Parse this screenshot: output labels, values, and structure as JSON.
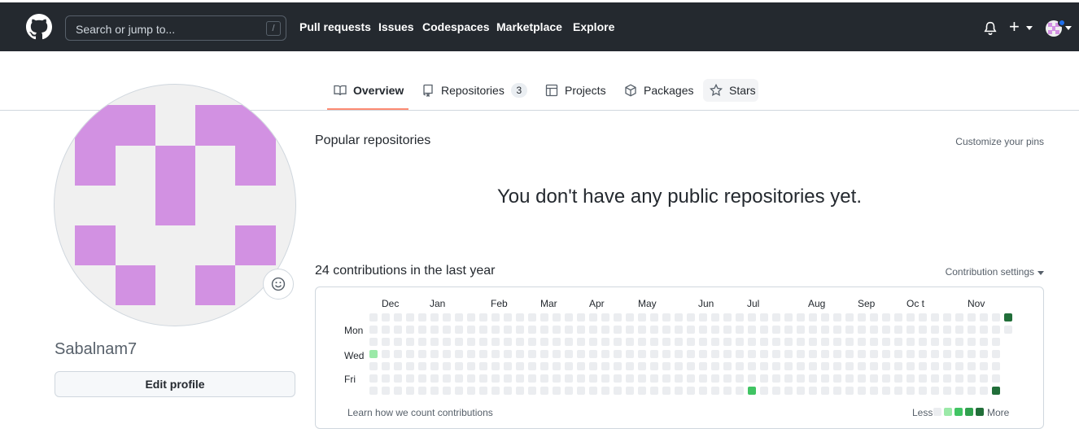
{
  "header": {
    "search_placeholder": "Search or jump to...",
    "search_shortcut": "/",
    "nav": [
      "Pull requests",
      "Issues",
      "Codespaces",
      "Marketplace",
      "Explore"
    ],
    "plus_label": "+"
  },
  "tabs": [
    {
      "label": "Overview",
      "icon": "book-icon",
      "selected": true
    },
    {
      "label": "Repositories",
      "icon": "repo-icon",
      "count": "3"
    },
    {
      "label": "Projects",
      "icon": "project-table-icon"
    },
    {
      "label": "Packages",
      "icon": "package-icon"
    },
    {
      "label": "Stars",
      "icon": "star-icon"
    }
  ],
  "profile": {
    "username": "Sabalnam7",
    "edit_button": "Edit profile",
    "identicon_color": "#d291e2"
  },
  "popular": {
    "title": "Popular repositories",
    "customize_link": "Customize your pins",
    "empty_message": "You don't have any public repositories yet."
  },
  "contributions": {
    "title": "24 contributions in the last year",
    "settings_link": "Contribution settings",
    "months": [
      "Dec",
      "Jan",
      "Feb",
      "Mar",
      "Apr",
      "May",
      "Jun",
      "Jul",
      "Aug",
      "Sep",
      "Oc t",
      "Nov"
    ],
    "day_labels": [
      "Mon",
      "Wed",
      "Fri"
    ],
    "learn_link": "Learn how we count contributions",
    "legend_less": "Less",
    "legend_more": "More",
    "legend_colors": [
      "#ebedf0",
      "#9be9a8",
      "#40c463",
      "#30a14e",
      "#216e39"
    ],
    "weeks": 53,
    "last_week_days": 2,
    "active_cells": [
      {
        "week": 0,
        "day": 3,
        "level": 1
      },
      {
        "week": 31,
        "day": 6,
        "level": 2
      },
      {
        "week": 51,
        "day": 6,
        "level": 4
      },
      {
        "week": 52,
        "day": 0,
        "level": 4
      }
    ]
  }
}
